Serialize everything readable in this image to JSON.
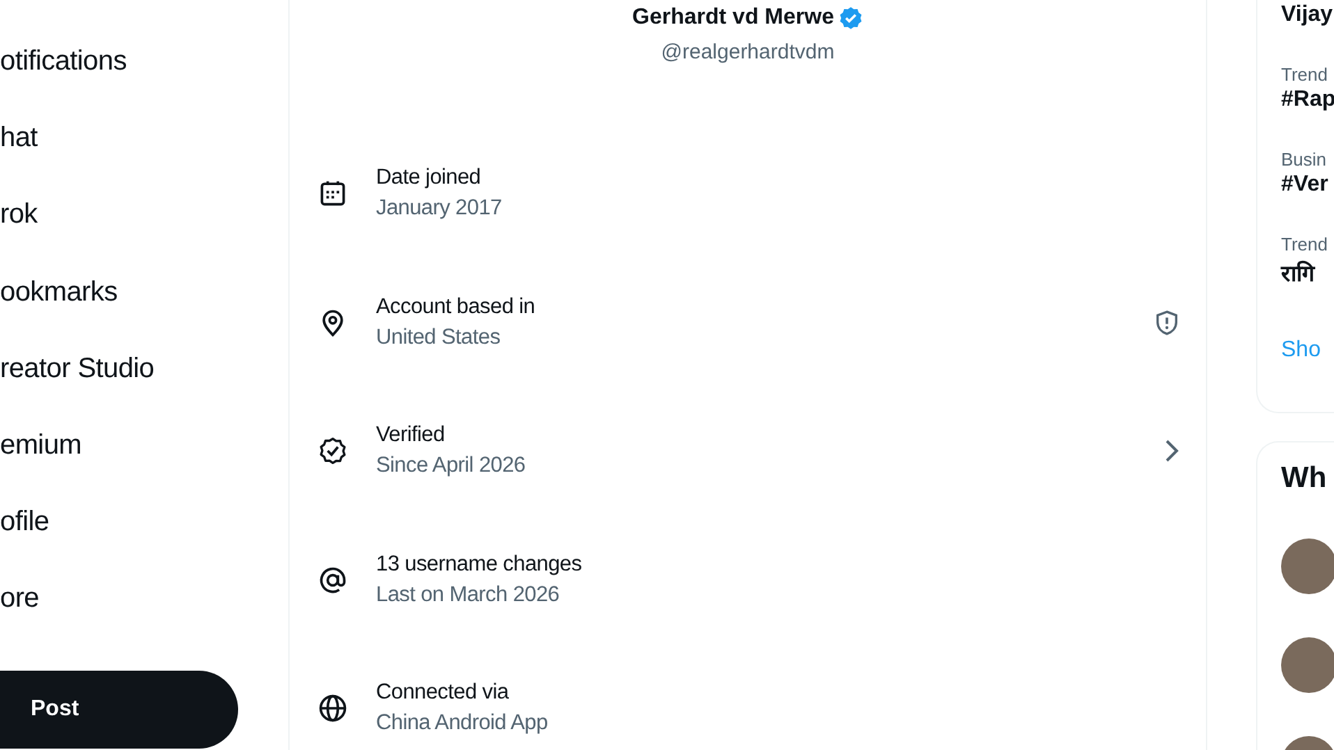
{
  "nav": {
    "items": [
      {
        "label": "otifications"
      },
      {
        "label": "hat"
      },
      {
        "label": "rok"
      },
      {
        "label": "ookmarks"
      },
      {
        "label": "reator Studio"
      },
      {
        "label": "emium"
      },
      {
        "label": "ofile"
      },
      {
        "label": "ore"
      }
    ],
    "post_button": "Post"
  },
  "profile": {
    "name": "Gerhardt vd Merwe",
    "verified": true,
    "handle": "@realgerhardtvdm"
  },
  "about_rows": [
    {
      "kind": "calendar",
      "title": "Date joined",
      "value": "January 2017",
      "warning": false,
      "expandable": false
    },
    {
      "kind": "location",
      "title": "Account based in",
      "value": "United States",
      "warning": true,
      "expandable": false
    },
    {
      "kind": "verified",
      "title": "Verified",
      "value": "Since April 2026",
      "warning": false,
      "expandable": true
    },
    {
      "kind": "at",
      "title": "13 username changes",
      "value": "Last on March 2026",
      "warning": false,
      "expandable": false
    },
    {
      "kind": "globe",
      "title": "Connected via",
      "value": "China Android App",
      "warning": false,
      "expandable": false
    }
  ],
  "trends": {
    "top_title": "Vijay",
    "items": [
      {
        "context": "Trend",
        "topic": "#Rap"
      },
      {
        "context": "Busin",
        "topic": "#Ver"
      },
      {
        "context": "Trend",
        "topic": "रागि"
      }
    ],
    "show_more": "Sho"
  },
  "who_to_follow": {
    "title": "Wh",
    "people": [
      {
        "kind": "photo"
      },
      {
        "kind": "photo"
      },
      {
        "kind": "photo"
      }
    ]
  }
}
